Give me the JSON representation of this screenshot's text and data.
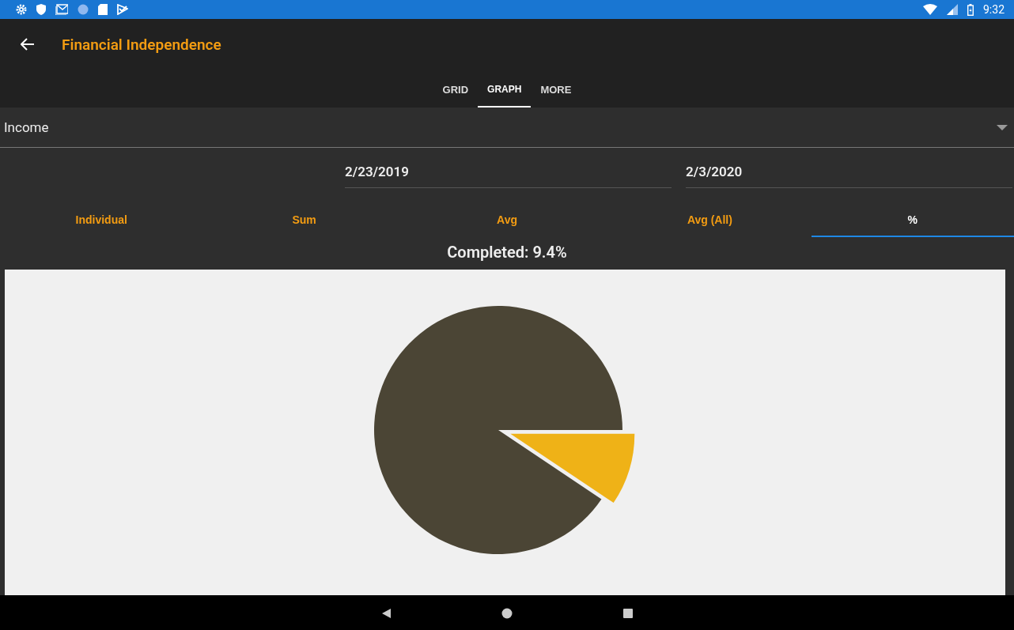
{
  "status_bar": {
    "time": "9:32"
  },
  "toolbar": {
    "title": "Financial Independence"
  },
  "tabs": [
    {
      "label": "GRID",
      "selected": false
    },
    {
      "label": "GRAPH",
      "selected": true
    },
    {
      "label": "MORE",
      "selected": false
    }
  ],
  "dropdown": {
    "value": "Income"
  },
  "date_range": {
    "start": "2/23/2019",
    "end": "2/3/2020"
  },
  "graph_modes": [
    {
      "label": "Individual",
      "selected": false
    },
    {
      "label": "Sum",
      "selected": false
    },
    {
      "label": "Avg",
      "selected": false
    },
    {
      "label": "Avg (All)",
      "selected": false
    },
    {
      "label": "%",
      "selected": true
    }
  ],
  "summary": "Completed: 9.4%",
  "chart": {
    "chart_data": {
      "type": "pie",
      "values": [
        90.6,
        9.4
      ]
    }
  }
}
